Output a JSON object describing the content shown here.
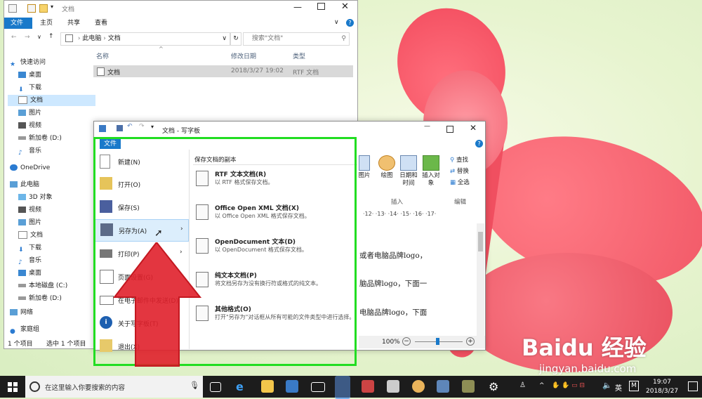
{
  "explorer": {
    "title": "文档",
    "tabs": [
      "文件",
      "主页",
      "共享",
      "查看"
    ],
    "path": [
      "此电脑",
      "文档"
    ],
    "search_placeholder": "搜索\"文档\"",
    "columns": {
      "name": "名称",
      "modified": "修改日期",
      "type": "类型"
    },
    "file": {
      "name": "文档",
      "modified": "2018/3/27 19:02",
      "type": "RTF 文档"
    },
    "nav": [
      {
        "label": "快速访问",
        "icon": "star-icon"
      },
      {
        "label": "桌面",
        "icon": "desktop-icon"
      },
      {
        "label": "下载",
        "icon": "download-icon"
      },
      {
        "label": "文档",
        "icon": "document-icon"
      },
      {
        "label": "图片",
        "icon": "pictures-icon"
      },
      {
        "label": "视频",
        "icon": "video-icon"
      },
      {
        "label": "新加卷 (D:)",
        "icon": "drive-icon"
      },
      {
        "label": "音乐",
        "icon": "music-icon"
      },
      {
        "label": "OneDrive",
        "icon": "cloud-icon"
      },
      {
        "label": "此电脑",
        "icon": "computer-icon"
      },
      {
        "label": "3D 对象",
        "icon": "3d-icon"
      },
      {
        "label": "视频",
        "icon": "video-icon"
      },
      {
        "label": "图片",
        "icon": "pictures-icon"
      },
      {
        "label": "文档",
        "icon": "document-icon"
      },
      {
        "label": "下载",
        "icon": "download-icon"
      },
      {
        "label": "音乐",
        "icon": "music-icon"
      },
      {
        "label": "桌面",
        "icon": "desktop-icon"
      },
      {
        "label": "本地磁盘 (C:)",
        "icon": "drive-icon"
      },
      {
        "label": "新加卷 (D:)",
        "icon": "drive-icon"
      },
      {
        "label": "网络",
        "icon": "network-icon"
      },
      {
        "label": "家庭组",
        "icon": "homegroup-icon"
      }
    ],
    "status_left": "1 个项目",
    "status_sel": "选中 1 个项目"
  },
  "wordpad": {
    "title": "文档 - 写字板",
    "file_tab": "文件",
    "menu": [
      {
        "label": "新建(N)",
        "icon": "new-doc-icon"
      },
      {
        "label": "打开(O)",
        "icon": "open-folder-icon"
      },
      {
        "label": "保存(S)",
        "icon": "save-icon"
      },
      {
        "label": "另存为(A)",
        "icon": "save-as-icon"
      },
      {
        "label": "打印(P)",
        "icon": "print-icon"
      },
      {
        "label": "页面设置(G)",
        "icon": "page-setup-icon"
      },
      {
        "label": "在电子邮件中发送(D)",
        "icon": "email-icon"
      },
      {
        "label": "关于写字板(T)",
        "icon": "info-icon"
      },
      {
        "label": "退出(X)",
        "icon": "exit-icon"
      }
    ],
    "saveas_header": "保存文档的副本",
    "saveas": [
      {
        "title": "RTF 文本文档(R)",
        "desc": "以 RTF 格式保存文档。"
      },
      {
        "title": "Office Open XML 文档(X)",
        "desc": "以 Office Open XML 格式保存文档。"
      },
      {
        "title": "OpenDocument 文本(D)",
        "desc": "以 OpenDocument 格式保存文档。"
      },
      {
        "title": "纯文本文档(P)",
        "desc": "将文档另存为没有换行符或格式的纯文本。"
      },
      {
        "title": "其他格式(O)",
        "desc": "打开\"另存为\"对话框从所有可能的文件类型中进行选择。"
      }
    ],
    "ribbon": {
      "buttons": [
        "图片",
        "绘图",
        "日期和时间",
        "插入对象"
      ],
      "edit": [
        "查找",
        "替换",
        "全选"
      ],
      "group_insert": "插入",
      "group_edit": "编辑"
    },
    "ruler": "·12·  ·13·  ·14·  ·15·  ·16·  ·17·",
    "doc_lines": [
      "或者电脑品牌logo，",
      "脑品牌logo，下面一",
      "电脑品牌logo，下面"
    ],
    "zoom": "100%"
  },
  "taskbar": {
    "search_placeholder": "在这里输入你要搜索的内容",
    "ime": "英",
    "time": "19:07",
    "date": "2018/3/27"
  },
  "watermark": {
    "brand": "Baidu 经验",
    "url": "jingyan.baidu.com"
  },
  "colors": {
    "accent": "#1979ca",
    "highlight": "#22dd22",
    "arrow": "#e0202b",
    "taskbar": "#1c1c1c"
  }
}
